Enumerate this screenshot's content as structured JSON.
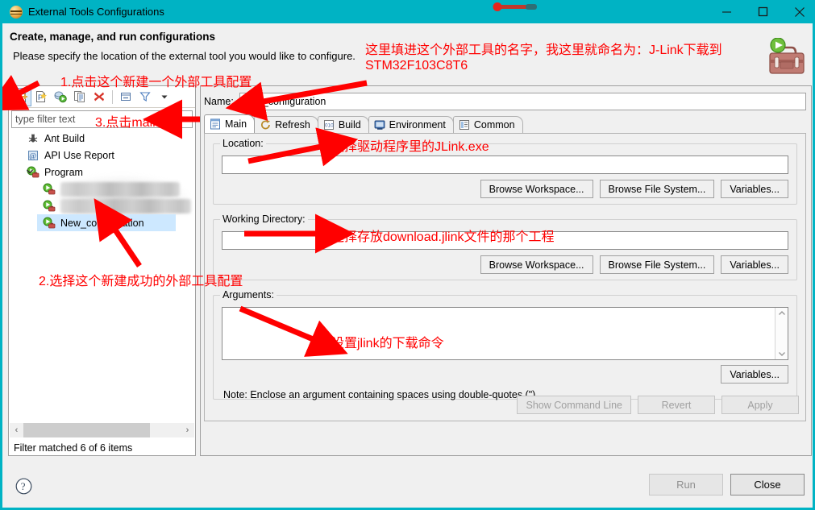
{
  "window": {
    "title": "External Tools Configurations",
    "icon": "eclipse-external-tools-icon",
    "controls": {
      "minimize": "minimize-icon",
      "maximize": "maximize-icon",
      "close": "close-icon"
    }
  },
  "header": {
    "title": "Create, manage, and run configurations",
    "subtitle": "Please specify the location of the external tool you would like to configure.",
    "decor_icon": "toolbox-icon"
  },
  "left_panel": {
    "toolbar": [
      {
        "name": "new-configuration-button",
        "icon": "new-document-icon",
        "selected": true
      },
      {
        "name": "new-prototype-button",
        "icon": "new-prototype-icon",
        "selected": false
      },
      {
        "name": "export-button",
        "icon": "export-icon",
        "selected": false
      },
      {
        "name": "duplicate-button",
        "icon": "duplicate-icon",
        "selected": false
      },
      {
        "name": "delete-button",
        "icon": "delete-x-icon",
        "selected": false
      },
      {
        "name": "collapse-all-button",
        "icon": "collapse-all-icon",
        "selected": false
      },
      {
        "name": "filter-button",
        "icon": "filter-funnel-icon",
        "selected": false
      },
      {
        "name": "view-menu-button",
        "icon": "chevron-down-icon",
        "selected": false
      }
    ],
    "filter": {
      "placeholder": "type filter text",
      "value": ""
    },
    "tree": [
      {
        "label": "Ant Build",
        "icon": "ant-build-icon",
        "level": 0,
        "expandable": false,
        "selected": false,
        "blurred": false
      },
      {
        "label": "API Use Report",
        "icon": "api-use-report-icon",
        "level": 0,
        "expandable": false,
        "selected": false,
        "blurred": false
      },
      {
        "label": "Program",
        "icon": "program-icon",
        "level": 0,
        "expandable": true,
        "expanded": true,
        "selected": false,
        "blurred": false
      },
      {
        "label": "",
        "icon": "program-icon",
        "level": 1,
        "expandable": false,
        "selected": false,
        "blurred": true
      },
      {
        "label": "",
        "icon": "program-icon",
        "level": 1,
        "expandable": false,
        "selected": false,
        "blurred": true
      },
      {
        "label": "New_configuration",
        "icon": "program-icon",
        "level": 1,
        "expandable": false,
        "selected": true,
        "blurred": false
      }
    ],
    "scrollbar": {
      "left_arrow": "‹",
      "right_arrow": "›"
    },
    "status": "Filter matched 6 of 6 items"
  },
  "right_panel": {
    "name_label": "Name:",
    "name_value": "New_configuration",
    "tabs": [
      {
        "label": "Main",
        "icon": "main-tab-icon",
        "active": true
      },
      {
        "label": "Refresh",
        "icon": "refresh-tab-icon",
        "active": false
      },
      {
        "label": "Build",
        "icon": "build-tab-icon",
        "active": false
      },
      {
        "label": "Environment",
        "icon": "environment-tab-icon",
        "active": false
      },
      {
        "label": "Common",
        "icon": "common-tab-icon",
        "active": false
      }
    ],
    "location": {
      "label": "Location:",
      "value": "",
      "buttons": [
        "Browse Workspace...",
        "Browse File System...",
        "Variables..."
      ]
    },
    "working_directory": {
      "label": "Working Directory:",
      "value": "",
      "buttons": [
        "Browse Workspace...",
        "Browse File System...",
        "Variables..."
      ]
    },
    "arguments": {
      "label": "Arguments:",
      "value": "",
      "variables_button": "Variables...",
      "note": "Note: Enclose an argument containing spaces using double-quotes (\")."
    },
    "action_buttons": [
      {
        "label": "Show Command Line",
        "enabled": false
      },
      {
        "label": "Revert",
        "enabled": false
      },
      {
        "label": "Apply",
        "enabled": false
      }
    ]
  },
  "footer": {
    "help_icon": "help-question-icon",
    "buttons": [
      {
        "label": "Run",
        "enabled": false
      },
      {
        "label": "Close",
        "enabled": true
      }
    ]
  },
  "annotations": [
    {
      "id": "a1",
      "text": "1.点击这个新建一个外部工具配置"
    },
    {
      "id": "a2",
      "text": "2.选择这个新建成功的外部工具配置"
    },
    {
      "id": "a3",
      "text": "3.点击main"
    },
    {
      "id": "a4_line1",
      "text": "这里填进这个外部工具的名字，我这里就命名为：J-Link下载到"
    },
    {
      "id": "a4_line2",
      "text": "STM32F103C8T6"
    },
    {
      "id": "a5",
      "text": "选择驱动程序里的JLink.exe"
    },
    {
      "id": "a6",
      "text": "选择存放download.jlink文件的那个工程"
    },
    {
      "id": "a7",
      "text": "设置jlink的下载命令"
    }
  ],
  "colors": {
    "titlebar": "#00b3c4",
    "annotation": "#ff0000",
    "selection": "#cde8ff",
    "panel": "#f0f0f0"
  }
}
